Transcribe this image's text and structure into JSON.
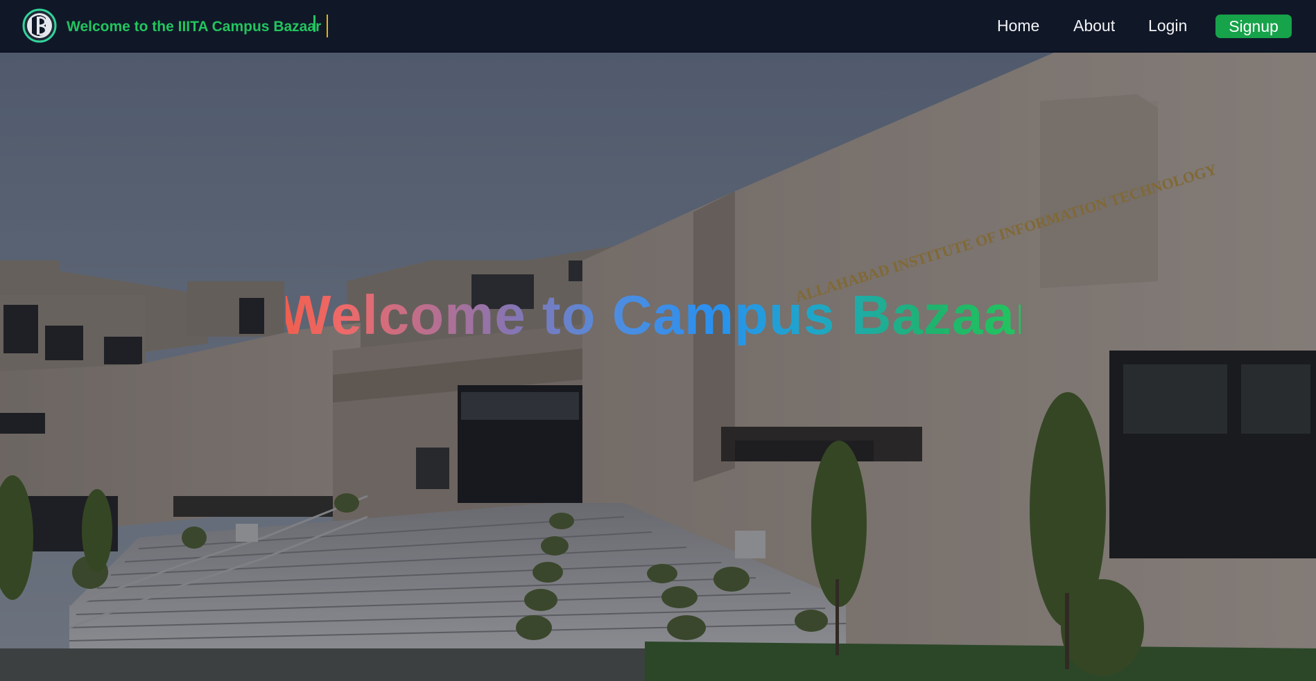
{
  "navbar": {
    "brand_text": "Welcome to the IIITA Campus Bazaar",
    "logo_icon": "campus-bazaar-logo",
    "links": {
      "home": "Home",
      "about": "About",
      "login": "Login",
      "signup": "Signup"
    }
  },
  "hero": {
    "title": "Welcome to Campus Bazaar",
    "background": "IIITA campus building photograph"
  },
  "colors": {
    "nav_bg": "#101828",
    "brand_green": "#22c55e",
    "signup_bg": "#16a34a",
    "gradient_start": "#ef5f4f",
    "gradient_mid": "#2a90f0",
    "gradient_end": "#22c55e"
  }
}
